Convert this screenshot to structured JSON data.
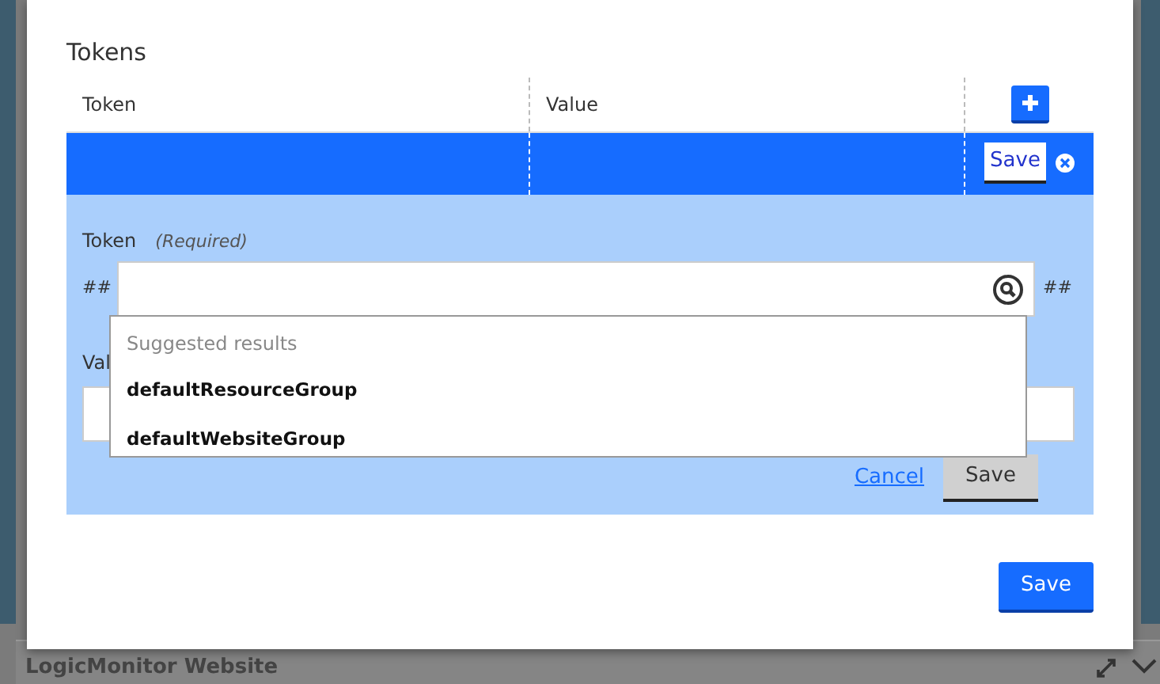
{
  "background": {
    "panel_title": "LogicMonitor Website"
  },
  "dialog": {
    "title": "Tokens",
    "table": {
      "columns": [
        "Token",
        "Value"
      ],
      "rows": [
        {
          "selected": true,
          "save_label": "Save"
        }
      ]
    },
    "editor": {
      "token_label": "Token",
      "token_hint": "(Required)",
      "prefix": "##",
      "suffix": "##",
      "value_label": "Val",
      "suggestions": {
        "heading": "Suggested results",
        "items": [
          "defaultResourceGroup",
          "defaultWebsiteGroup"
        ]
      },
      "cancel": "Cancel",
      "save": "Save"
    },
    "footer_button": "Save"
  }
}
